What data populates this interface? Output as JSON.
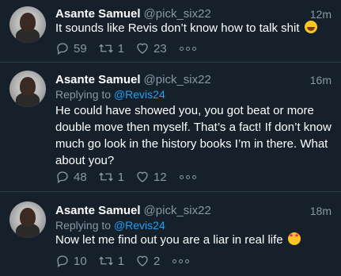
{
  "tweets": [
    {
      "name": "Asante Samuel",
      "handle": "@pick_six22",
      "time": "12m",
      "replying_prefix": "",
      "replying_to": "",
      "text": "It sounds like Revis don’t know how to talk shit",
      "emoji": "rolling-on-floor-laughing-emoji",
      "replies": "59",
      "retweets": "1",
      "likes": "23"
    },
    {
      "name": "Asante Samuel",
      "handle": "@pick_six22",
      "time": "16m",
      "replying_prefix": "Replying to",
      "replying_to": "@Revis24",
      "text": "He could have showed you, you got beat or more double move then myself. That’s a fact! If don’t know much go look in the history books I’m in there. What about you?",
      "emoji": "",
      "replies": "48",
      "retweets": "1",
      "likes": "12"
    },
    {
      "name": "Asante Samuel",
      "handle": "@pick_six22",
      "time": "18m",
      "replying_prefix": "Replying to",
      "replying_to": "@Revis24",
      "text": "Now let me find out you are a liar in real life",
      "emoji": "star-struck-emoji",
      "replies": "10",
      "retweets": "1",
      "likes": "2"
    }
  ],
  "colors": {
    "background": "#15202b",
    "secondary_text": "#8899a6",
    "link": "#1da1f2",
    "divider": "#2f3d4a"
  },
  "icons": [
    "reply-icon",
    "retweet-icon",
    "like-icon",
    "more-icon"
  ]
}
